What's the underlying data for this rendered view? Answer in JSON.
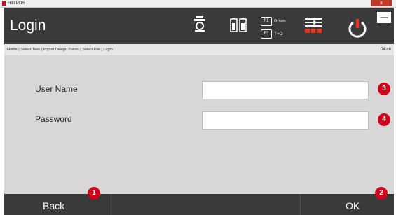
{
  "window": {
    "title": "Hilti POS",
    "close_label": "x"
  },
  "header": {
    "title": "Login",
    "f1_key": "F1",
    "f1_label": "Prism",
    "f2_key": "F2",
    "f2_label": "T+D",
    "minimize_label": "—"
  },
  "breadcrumb": {
    "path": "Home | Select Task | Import Design Points | Select File | Login",
    "time": "04:46"
  },
  "form": {
    "username_label": "User Name",
    "username_value": "",
    "password_label": "Password",
    "password_value": ""
  },
  "footer": {
    "back_label": "Back",
    "ok_label": "OK"
  },
  "callouts": {
    "c1": "1",
    "c2": "2",
    "c3": "3",
    "c4": "4"
  },
  "colors": {
    "header_bg": "#3a3a3a",
    "content_bg": "#d7d7d7",
    "accent_red": "#d0021b"
  },
  "icons": [
    "app-icon",
    "instrument-icon",
    "battery-icon",
    "settings-icon",
    "power-icon"
  ]
}
